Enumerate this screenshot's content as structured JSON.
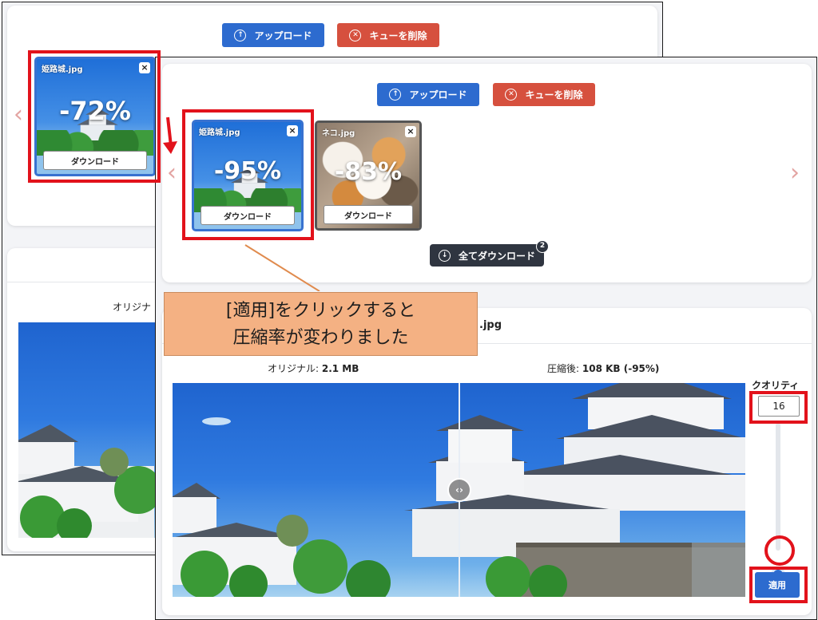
{
  "buttons": {
    "upload": "アップロード",
    "clear_queue": "キューを削除",
    "download_all": "全てダウンロード",
    "download_all_count": "2",
    "apply": "適用"
  },
  "back_window": {
    "thumbnail": {
      "filename": "姫路城.jpg",
      "reduction": "-72%",
      "download_label": "ダウンロード"
    },
    "original_label": "オリジナ"
  },
  "front_window": {
    "thumbnails": [
      {
        "filename": "姫路城.jpg",
        "reduction": "-95%",
        "download_label": "ダウンロード"
      },
      {
        "filename": "ネコ.jpg",
        "reduction": "-83%",
        "download_label": "ダウンロード"
      }
    ],
    "file_title_suffix": ".jpg",
    "original": {
      "label": "オリジナル:",
      "size": "2.1 MB"
    },
    "compressed": {
      "label": "圧縮後:",
      "size": "108 KB (-95%)"
    },
    "quality": {
      "label": "クオリティ",
      "value": "16",
      "level_fraction": 0.16
    }
  },
  "callout": {
    "line1": "[適用]をクリックすると",
    "line2": "圧縮率が変わりました"
  },
  "icons": {
    "upload": "arrow-up-circle-icon",
    "clear": "x-circle-icon",
    "download_all": "arrow-down-circle-icon",
    "close": "close-icon",
    "compare_handle": "chevron-left-right-icon"
  },
  "colors": {
    "primary": "#2d6bcf",
    "danger": "#d6503e",
    "dark": "#2f3540",
    "highlight": "#e2121b",
    "callout": "#f4b183"
  }
}
